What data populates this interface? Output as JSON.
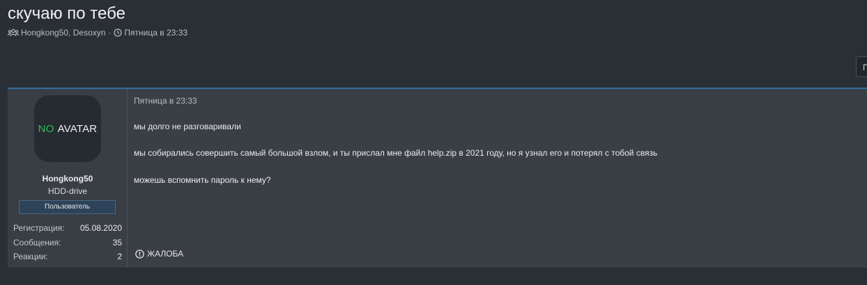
{
  "thread": {
    "title": "скучаю по тебе",
    "participants": "Hongkong50, Desoxyn",
    "separator": "·",
    "date": "Пятница в 23:33",
    "participants_icon": "users-icon",
    "date_icon": "clock-icon"
  },
  "corner_button": {
    "label": "П"
  },
  "post": {
    "user": {
      "avatar_no": "NO",
      "avatar_text": "AVATAR",
      "name": "Hongkong50",
      "title": "HDD-drive",
      "role": "Пользователь",
      "stats": [
        {
          "label": "Регистрация:",
          "value": "05.08.2020"
        },
        {
          "label": "Сообщения:",
          "value": "35"
        },
        {
          "label": "Реакции:",
          "value": "2"
        }
      ]
    },
    "date": "Пятница в 23:33",
    "lines": [
      "мы долго не разговаривали",
      "мы собирались совершить самый большой взлом, и ты прислал мне файл help.zip в 2021 году, но я узнал его и потерял с тобой связь",
      "можешь вспомнить пароль к нему?"
    ],
    "report_label": "ЖАЛОБА",
    "report_icon": "alert-circle-icon"
  },
  "colors": {
    "background": "#2a2e35",
    "post_background": "#3a3e45",
    "accent_border": "#2f6fa3",
    "avatar_no": "#2ebd5a",
    "badge_background": "#2d4359"
  }
}
